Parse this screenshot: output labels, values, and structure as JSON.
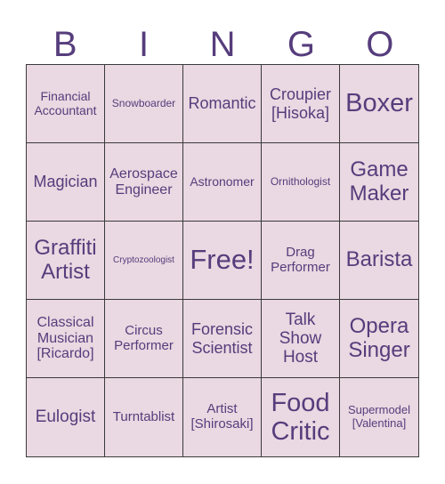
{
  "header": {
    "letters": [
      "B",
      "I",
      "N",
      "G",
      "O"
    ]
  },
  "colors": {
    "text": "#563d7c",
    "cell_fill": "#ead8e2",
    "grid_line": "#3a3a3a",
    "background": "#ffffff"
  },
  "board": {
    "rows": [
      [
        "Financial\nAccountant",
        "Snowboarder",
        "Romantic",
        "Croupier\n[Hisoka]",
        "Boxer"
      ],
      [
        "Magician",
        "Aerospace\nEngineer",
        "Astronomer",
        "Ornithologist",
        "Game\nMaker"
      ],
      [
        "Graffiti\nArtist",
        "Cryptozoologist",
        "Free!",
        "Drag\nPerformer",
        "Barista"
      ],
      [
        "Classical\nMusician\n[Ricardo]",
        "Circus\nPerformer",
        "Forensic\nScientist",
        "Talk\nShow\nHost",
        "Opera\nSinger"
      ],
      [
        "Eulogist",
        "Turntablist",
        "Artist\n[Shirosaki]",
        "Food\nCritic",
        "Supermodel\n[Valentina]"
      ]
    ]
  }
}
